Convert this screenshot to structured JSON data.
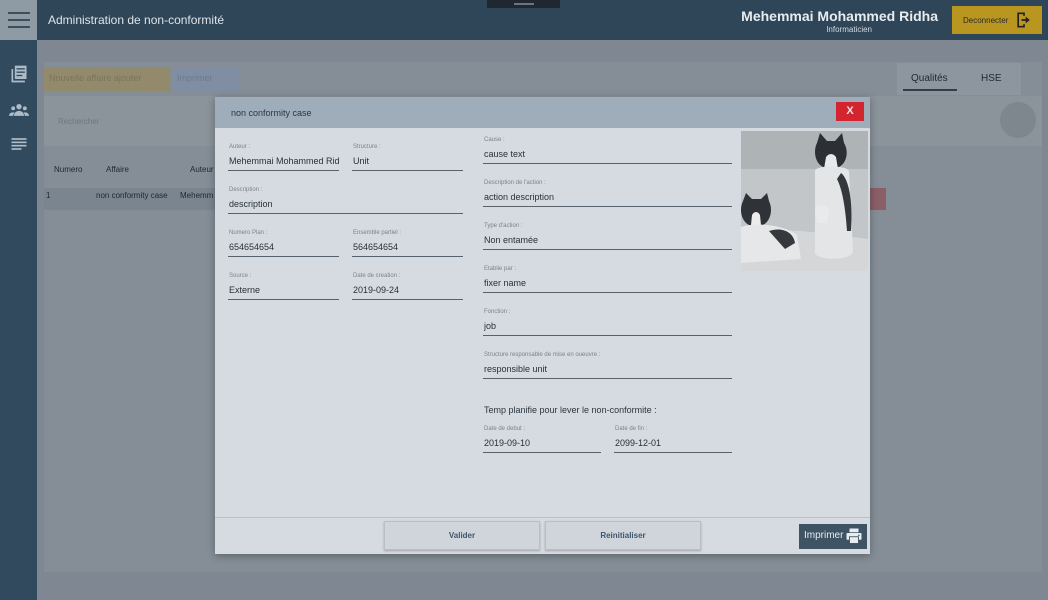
{
  "header": {
    "app_title": "Administration de non-conformité",
    "user_name": "Mehemmai Mohammed Ridha",
    "user_role": "Informaticien",
    "logout_label": "Deconnecter"
  },
  "background": {
    "buttons": [
      "Nouvelle affaire ajouter",
      "Imprimer"
    ],
    "tabs": [
      "Qualités",
      "HSE"
    ],
    "search_placeholder": "Rechercher",
    "table": {
      "columns": [
        "Numero",
        "Affaire",
        "Auteur"
      ],
      "rows": [
        [
          "1",
          "non conformity case",
          "Mehemm"
        ]
      ]
    }
  },
  "modal": {
    "title": "non conformity case",
    "close_label": "X",
    "left_fields": {
      "auteur": {
        "label": "Auteur :",
        "value": "Mehemmai Mohammed Ridha"
      },
      "structure": {
        "label": "Structure :",
        "value": "Unit"
      },
      "description": {
        "label": "Description :",
        "value": "description"
      },
      "numero_plan": {
        "label": "Numero Plan :",
        "value": "654654654"
      },
      "ensemble_partiel": {
        "label": "Ensemble partiel :",
        "value": "564654654"
      },
      "source": {
        "label": "Source :",
        "value": "Externe"
      },
      "date_creation": {
        "label": "Date de creation :",
        "value": "2019-09-24"
      }
    },
    "right_fields": {
      "cause": {
        "label": "Cause :",
        "value": "cause text"
      },
      "description_action": {
        "label": "Description de l'action :",
        "value": "action description"
      },
      "type_action": {
        "label": "Type d'action :",
        "value": "Non entamée"
      },
      "etablie_par": {
        "label": "Etablie par :",
        "value": "fixer name"
      },
      "fonction": {
        "label": "Fonction :",
        "value": "job"
      },
      "structure_responsable": {
        "label": "Structure responsable de mise en oueuvre :",
        "value": "responsible unit"
      }
    },
    "planning": {
      "title": "Temp planifie pour lever le non-conformite :",
      "date_debut": {
        "label": "Date de debut :",
        "value": "2019-09-10"
      },
      "date_fin": {
        "label": "Date de fin :",
        "value": "2099-12-01"
      }
    },
    "footer": {
      "validate_label": "Valider",
      "reset_label": "Reinitialiser",
      "print_label": "Imprimer"
    }
  },
  "icons": {
    "menu": "hamburger-icon",
    "logout": "logout-icon",
    "sidebar": [
      "documents-icon",
      "users-icon",
      "list-icon"
    ],
    "print": "printer-icon",
    "search": "search-icon"
  },
  "colors": {
    "topbar": "#2f4558",
    "logout_button": "#b8961f",
    "close_button": "#d2252f",
    "print_button": "#3e5364"
  }
}
